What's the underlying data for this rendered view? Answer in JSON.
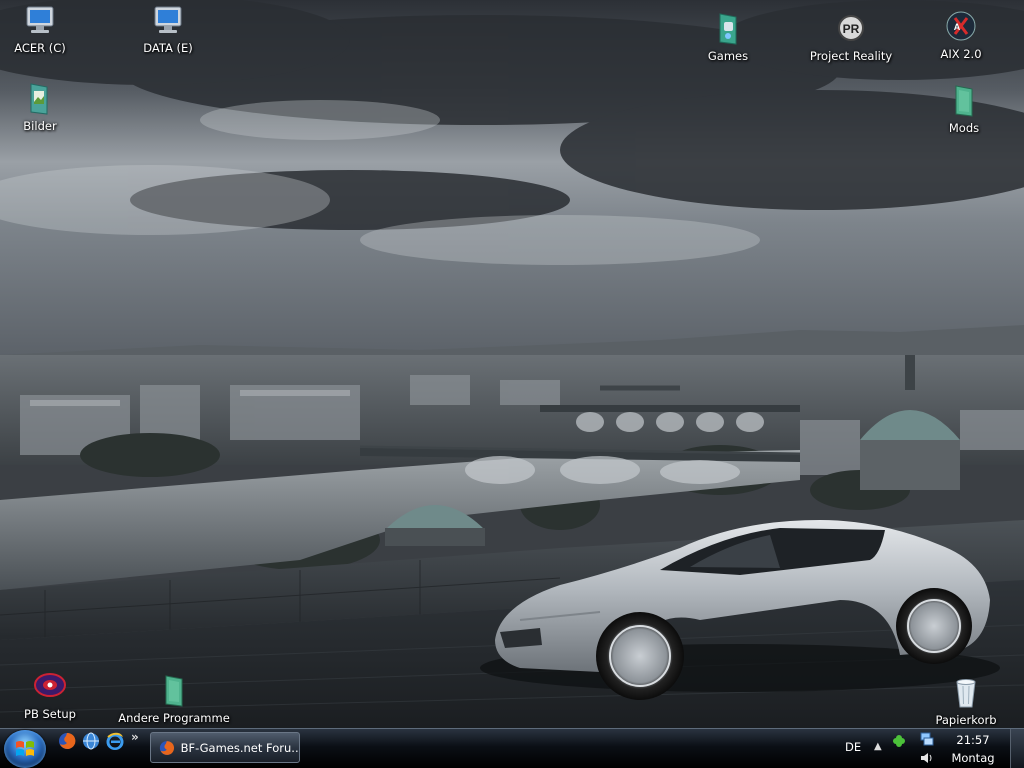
{
  "desktop": {
    "icons": [
      {
        "label": "ACER (C)",
        "icon": "drive-computer-icon"
      },
      {
        "label": "DATA (E)",
        "icon": "drive-computer-icon"
      },
      {
        "label": "Games",
        "icon": "games-folder-icon"
      },
      {
        "label": "Project Reality",
        "icon": "project-reality-icon"
      },
      {
        "label": "AIX 2.0",
        "icon": "aix-icon"
      },
      {
        "label": "Bilder",
        "icon": "pictures-folder-icon"
      },
      {
        "label": "Mods",
        "icon": "folder-icon"
      },
      {
        "label": "PB Setup",
        "icon": "punkbuster-icon"
      },
      {
        "label": "Andere Programme",
        "icon": "folder-icon"
      },
      {
        "label": "Papierkorb",
        "icon": "recycle-bin-icon"
      }
    ]
  },
  "taskbar": {
    "start_icon": "windows-logo-icon",
    "quick_launch": [
      "firefox-icon",
      "network-globe-icon",
      "internet-explorer-icon"
    ],
    "quick_launch_more": "»",
    "task": {
      "label": "BF-Games.net Foru...",
      "icon": "firefox-icon"
    },
    "language": "DE",
    "tray_arrow": "▲",
    "tray_icons": [
      "clover-icon",
      "network-icon",
      "volume-icon"
    ],
    "clock": {
      "time": "21:57",
      "day": "Montag"
    }
  },
  "colors": {
    "sky": "#4b5158",
    "taskbar": "#0b0f15",
    "car": "#b9bec4"
  }
}
